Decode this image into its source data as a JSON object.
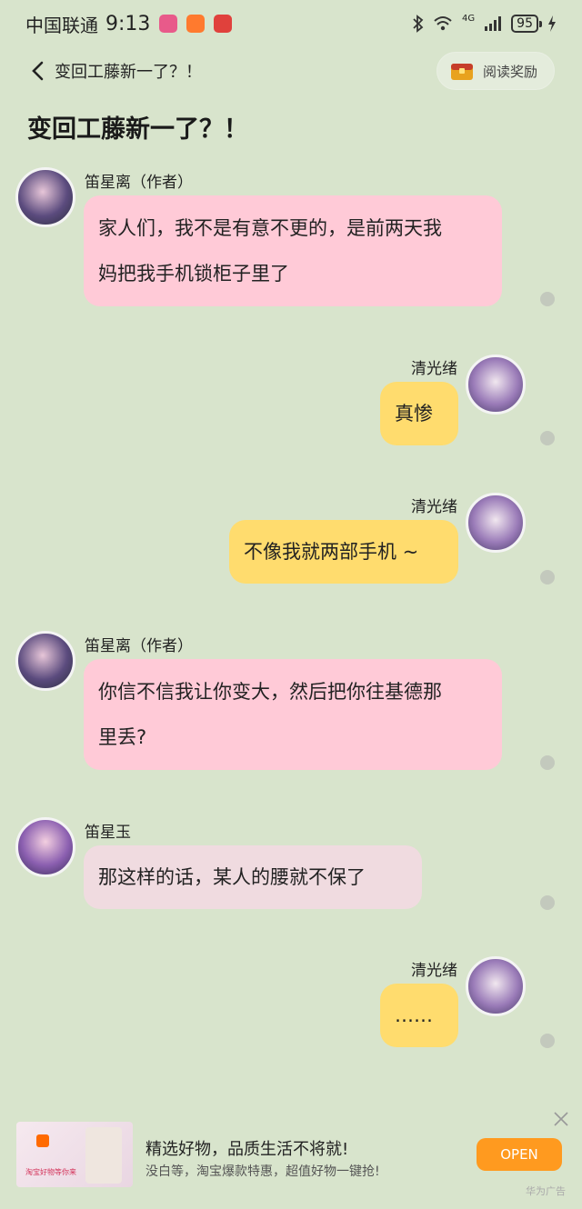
{
  "status_bar": {
    "carrier": "中国联通",
    "time": "9:13",
    "app_badges": [
      "#e85a8a",
      "#ff7a2e",
      "#e0413c"
    ],
    "network": "4G",
    "battery": "95"
  },
  "nav": {
    "title": "变回工藤新一了？！",
    "reward_label": "阅读奖励"
  },
  "page_title": "变回工藤新一了？！",
  "messages": [
    {
      "name": "笛星离（作者）",
      "text_lines": [
        "家人们，我不是有意不更的，是前两天我",
        "妈把我手机锁柜子里了"
      ]
    },
    {
      "name": "清光绪",
      "text_lines": [
        "真惨"
      ]
    },
    {
      "name": "清光绪",
      "text_lines": [
        "不像我就两部手机 ~"
      ]
    },
    {
      "name": "笛星离（作者）",
      "text_lines": [
        "你信不信我让你变大，然后把你往基德那",
        "里丢?"
      ]
    },
    {
      "name": "笛星玉",
      "text_lines": [
        "那这样的话，某人的腰就不保了"
      ]
    },
    {
      "name": "清光绪",
      "text_lines": [
        "……"
      ]
    }
  ],
  "ad": {
    "title": "精选好物，品质生活不将就!",
    "subtitle": "没白等，淘宝爆款特惠，超值好物一键抢!",
    "button": "OPEN",
    "label": "华为广告",
    "thumb_caption": "淘宝好物等你来"
  },
  "colors": {
    "background": "#d8e4cc",
    "bubble_author": "#ffcad7",
    "bubble_reader": "#f0dbe0",
    "bubble_self": "#ffdc6e",
    "open_button": "#ff9a1f"
  }
}
